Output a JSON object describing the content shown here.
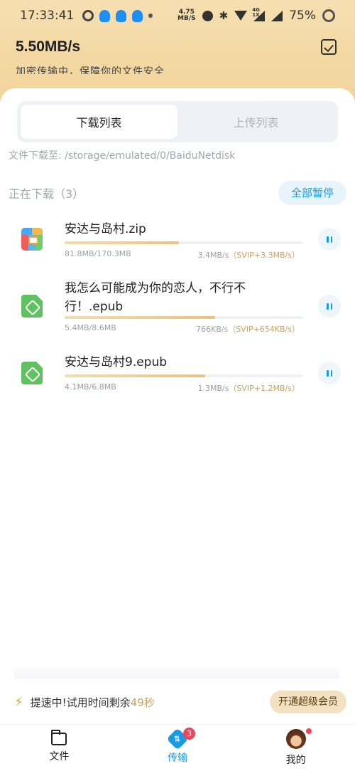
{
  "status_bar": {
    "time": "17:33:41",
    "net_speed_value": "4.75",
    "net_speed_unit": "MB/S",
    "signal_label_top": "4G",
    "signal_label_bottom": "1X",
    "battery": "75%"
  },
  "header": {
    "speed": "5.50MB/s",
    "secure_text": "加密传输中，保障你的文件安全"
  },
  "tabs": [
    {
      "label": "下载列表",
      "active": true
    },
    {
      "label": "上传列表",
      "active": false
    }
  ],
  "save_path": "文件下载至: /storage/emulated/0/BaiduNetdisk",
  "section": {
    "title": "正在下载（3）",
    "pause_all_label": "全部暂停"
  },
  "downloads": [
    {
      "name": "安达与岛村.zip",
      "size": "81.8MB/170.3MB",
      "speed": "3.4MB/s",
      "svip": "（SVIP+3.3MB/s）",
      "progress": 0.48,
      "icon": "zip-icon"
    },
    {
      "name": "我怎么可能成为你的恋人，不行不行！.epub",
      "size": "5.4MB/8.6MB",
      "speed": "766KB/s",
      "svip": "（SVIP+654KB/s）",
      "progress": 0.63,
      "icon": "epub-icon"
    },
    {
      "name": "安达与岛村9.epub",
      "size": "4.1MB/6.8MB",
      "speed": "1.3MB/s",
      "svip": "（SVIP+1.2MB/s）",
      "progress": 0.59,
      "icon": "epub-icon"
    }
  ],
  "boost": {
    "text": "提速中!试用时间剩余",
    "seconds": "49秒",
    "vip_button": "开通超级会员"
  },
  "bottom_nav": [
    {
      "label": "文件",
      "icon": "folder-icon",
      "active": false
    },
    {
      "label": "传输",
      "icon": "transfer-icon",
      "active": true,
      "badge": "3"
    },
    {
      "label": "我的",
      "icon": "avatar",
      "active": false
    }
  ],
  "colors": {
    "accent": "#1a9ae0",
    "gold": "#c8a062",
    "badge": "#f0465a"
  }
}
